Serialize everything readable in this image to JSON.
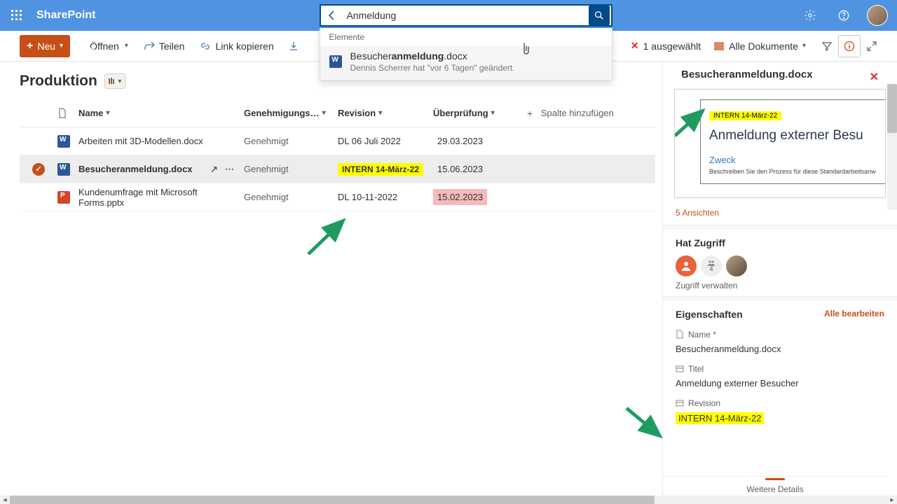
{
  "brand": "SharePoint",
  "search": {
    "query": "Anmeldung",
    "dropdown_header": "Elemente",
    "result_prefix": "Besucher",
    "result_match": "anmeldung",
    "result_suffix": ".docx",
    "result_sub": "Dennis Scherrer hat \"vor 6 Tagen\" geändert."
  },
  "cmdbar": {
    "new": "Neu",
    "open": "Öffnen",
    "share": "Teilen",
    "copylink": "Link kopieren",
    "selected": "1 ausgewählt",
    "view": "Alle Dokumente"
  },
  "page": {
    "title": "Produktion"
  },
  "columns": {
    "name": "Name",
    "approval": "Genehmigungs…",
    "revision": "Revision",
    "review": "Überprüfung",
    "addcol": "Spalte hinzufügen"
  },
  "rows": [
    {
      "type": "word",
      "name": "Arbeiten mit 3D-Modellen.docx",
      "approval": "Genehmigt",
      "revision": "DL 06 Juli 2022",
      "review": "29.03.2023",
      "hlRev": false,
      "hlReview": false,
      "selected": false
    },
    {
      "type": "word",
      "name": "Besucheranmeldung.docx",
      "approval": "Genehmigt",
      "revision": "INTERN 14-März-22",
      "review": "15.06.2023",
      "hlRev": true,
      "hlReview": false,
      "selected": true
    },
    {
      "type": "ppt",
      "name": "Kundenumfrage mit Microsoft Forms.pptx",
      "approval": "Genehmigt",
      "revision": "DL 10-11-2022",
      "review": "15.02.2023",
      "hlRev": false,
      "hlReview": true,
      "selected": false
    }
  ],
  "details": {
    "filename": "Besucheranmeldung.docx",
    "preview_tag": "INTERN 14-März-22",
    "preview_h1": "Anmeldung externer Besu",
    "preview_h2": "Zweck",
    "preview_p": "Beschreiben Sie den Prozess für diese Standardarbeitsanw",
    "views": "5 Ansichten",
    "access_title": "Hat Zugriff",
    "access_count": "4",
    "access_manage": "Zugriff verwalten",
    "props_title": "Eigenschaften",
    "edit_all": "Alle bearbeiten",
    "f_name_label": "Name *",
    "f_name_val": "Besucheranmeldung.docx",
    "f_title_label": "Titel",
    "f_title_val": "Anmeldung externer Besucher",
    "f_rev_label": "Revision",
    "f_rev_val": "INTERN 14-März-22",
    "footer": "Weitere Details"
  }
}
